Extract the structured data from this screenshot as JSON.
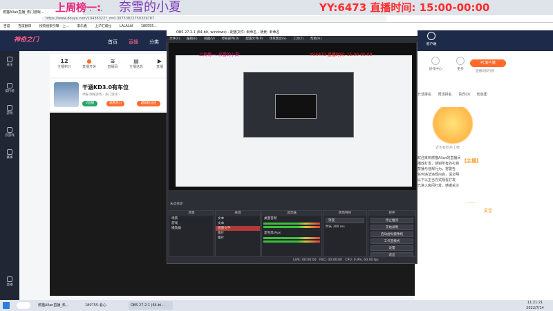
{
  "overlay": {
    "left_title": "上周榜一:",
    "name": "奈雪的小夏",
    "yy_line": "YY:6473  直播时间:  15:00-00:00"
  },
  "browser": {
    "active_tab": "燃猫Allan直播_热门游戏...",
    "address": "https://www.douyu.com/10436322?_z=0.30753822750329787",
    "bookmarks": [
      "百度",
      "百度翻译",
      "搜狗搜索引擎 - 上...",
      "李乐鑫",
      "上沪汇帮拉",
      "LALALAI",
      "180555..."
    ]
  },
  "site": {
    "logo": "神奇之门",
    "nav": [
      "首页",
      "直播",
      "分类"
    ],
    "left_nav": [
      "关注",
      "排行榜",
      "游戏",
      "云游戏",
      "赛事",
      "直播"
    ],
    "stats": [
      {
        "value": "12",
        "label": "主播积分"
      },
      {
        "value": "",
        "label": "直播开关"
      },
      {
        "value": "",
        "label": "直播码"
      },
      {
        "value": "",
        "label": "主播信息"
      },
      {
        "value": "",
        "label": "直播"
      }
    ],
    "room_title": "干涵KD3.0有车位",
    "room_sub": "举报  网络游戏 › 热门游戏 ›",
    "chips": [
      "V直播",
      "观看热力",
      "超级粉丝团"
    ],
    "right_icons": [
      "客户端",
      "创作中心",
      "消息",
      "投稿",
      "更多"
    ],
    "pc_button": "PC客户端",
    "right_small": "直播间排行榜",
    "rank_tabs": [
      "日活排名",
      "周活排名",
      "贵宾(0)",
      "粉丝团"
    ],
    "rank_empty": "近也有粉丝上榜",
    "chat_lines": [
      "欢迎来到燃猫Allan的直播间",
      "播放打发，感谢所有的礼物",
      "禁播与违规行为，将警告",
      "任何违法违规内容，请文明",
      "以下以正当方式观看打发",
      "已进入房间打发，感谢关注"
    ],
    "danmu": [
      "【主播】",
      "——",
      "夏雪"
    ]
  },
  "obs": {
    "title": "OBS 27.2.1 (64-bit, windows) - 配置文件: 未命名 - 场景: 未命名",
    "menu": [
      "文件(F)",
      "编辑(E)",
      "视图(V)",
      "停靠部件(D)",
      "配置文件(P)",
      "场景集合(S)",
      "工具(T)",
      "帮助(H)"
    ],
    "preview_overlay_left": "上周榜一: 奈雪的小夏",
    "preview_overlay_right": "YY:6473  直播时间: 15:00-00:00",
    "no_source": "未选择源",
    "panels": {
      "scenes": {
        "title": "场景",
        "items": [
          "场景",
          "游戏",
          "播放器"
        ]
      },
      "sources": {
        "title": "来源",
        "items": [
          "文本",
          "文本",
          "画面文字",
          "图片",
          "图片"
        ]
      },
      "mixer": {
        "title": "混音器",
        "tracks": [
          "桌面音频",
          "麦克风/Aux"
        ]
      },
      "transitions": {
        "title": "转场特效",
        "mode": "渐变",
        "duration_label": "时长",
        "duration": "300 ms"
      },
      "controls": {
        "title": "控件",
        "buttons": [
          "停止推流",
          "开始录制",
          "启动虚拟摄像机",
          "工作室模式",
          "设置",
          "退出"
        ]
      }
    },
    "status": {
      "live": "LIVE: 00:00:00",
      "rec": "REC: 00:00:00",
      "cpu": "CPU: 0.9%, 60.00 fps"
    }
  },
  "taskbar": {
    "items": [
      "燃猫Allan直播_热...",
      "180755-看心",
      "OBS 27.2.1 (64-bi..."
    ],
    "time": "11:21:21",
    "date": "2022/7/14"
  },
  "colors": {
    "overlay_pink": "#e8247a",
    "overlay_purple": "#7b3ab8",
    "overlay_red": "#ff2b2b",
    "accent_orange": "#ff6a2c"
  }
}
